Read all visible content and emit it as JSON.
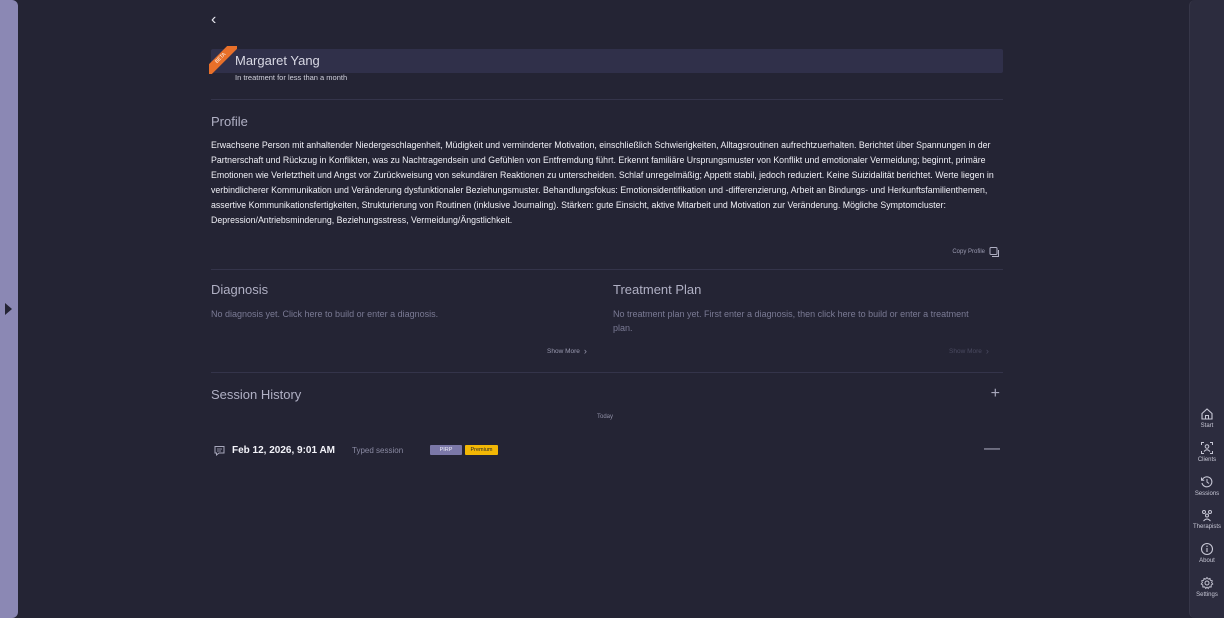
{
  "client": {
    "badge": "BETA",
    "name": "Margaret Yang",
    "treatment_duration": "In treatment for less than a month"
  },
  "profile": {
    "title": "Profile",
    "text": "Erwachsene Person mit anhaltender Niedergeschlagenheit, Müdigkeit und verminderter Motivation, einschließlich Schwierigkeiten, Alltagsroutinen aufrechtzuerhalten. Berichtet über Spannungen in der Partnerschaft und Rückzug in Konflikten, was zu Nachtragendsein und Gefühlen von Entfremdung führt. Erkennt familiäre Ursprungsmuster von Konflikt und emotionaler Vermeidung; beginnt, primäre Emotionen wie Verletztheit und Angst vor Zurückweisung von sekundären Reaktionen zu unterscheiden. Schlaf unregelmäßig; Appetit stabil, jedoch reduziert. Keine Suizidalität berichtet. Werte liegen in verbindlicherer Kommunikation und Veränderung dysfunktionaler Beziehungsmuster. Behandlungsfokus: Emotionsidentifikation und -differenzierung, Arbeit an Bindungs- und Herkunftsfamilienthemen, assertive Kommunikationsfertigkeiten, Strukturierung von Routinen (inklusive Journaling). Stärken: gute Einsicht, aktive Mitarbeit und Motivation zur Veränderung. Mögliche Symptomcluster: Depression/Antriebsminderung, Beziehungsstress, Vermeidung/Ängstlichkeit.",
    "copy_label": "Copy Profile"
  },
  "diagnosis": {
    "title": "Diagnosis",
    "empty_text": "No diagnosis yet. Click here to build or enter a diagnosis.",
    "show_more": "Show More"
  },
  "treatment_plan": {
    "title": "Treatment Plan",
    "empty_text": "No treatment plan yet. First enter a diagnosis, then click here to build or enter a treatment plan.",
    "show_more": "Show More"
  },
  "session_history": {
    "title": "Session History",
    "group_label": "Today",
    "sessions": [
      {
        "date": "Feb 12, 2026, 9:01 AM",
        "type": "Typed session",
        "tags": [
          "PIRP",
          "Premium"
        ]
      }
    ]
  },
  "nav": {
    "items": [
      {
        "label": "Start",
        "icon": "home-icon"
      },
      {
        "label": "Clients",
        "icon": "clients-icon"
      },
      {
        "label": "Sessions",
        "icon": "history-icon"
      },
      {
        "label": "Therapists",
        "icon": "therapists-icon"
      },
      {
        "label": "About",
        "icon": "info-icon"
      },
      {
        "label": "Settings",
        "icon": "gear-icon"
      }
    ]
  },
  "colors": {
    "background": "#242434",
    "left_rail": "#8b88b4",
    "ribbon": "#e8702a",
    "pirp_tag": "#7b78a8",
    "premium_tag": "#f2b705"
  }
}
